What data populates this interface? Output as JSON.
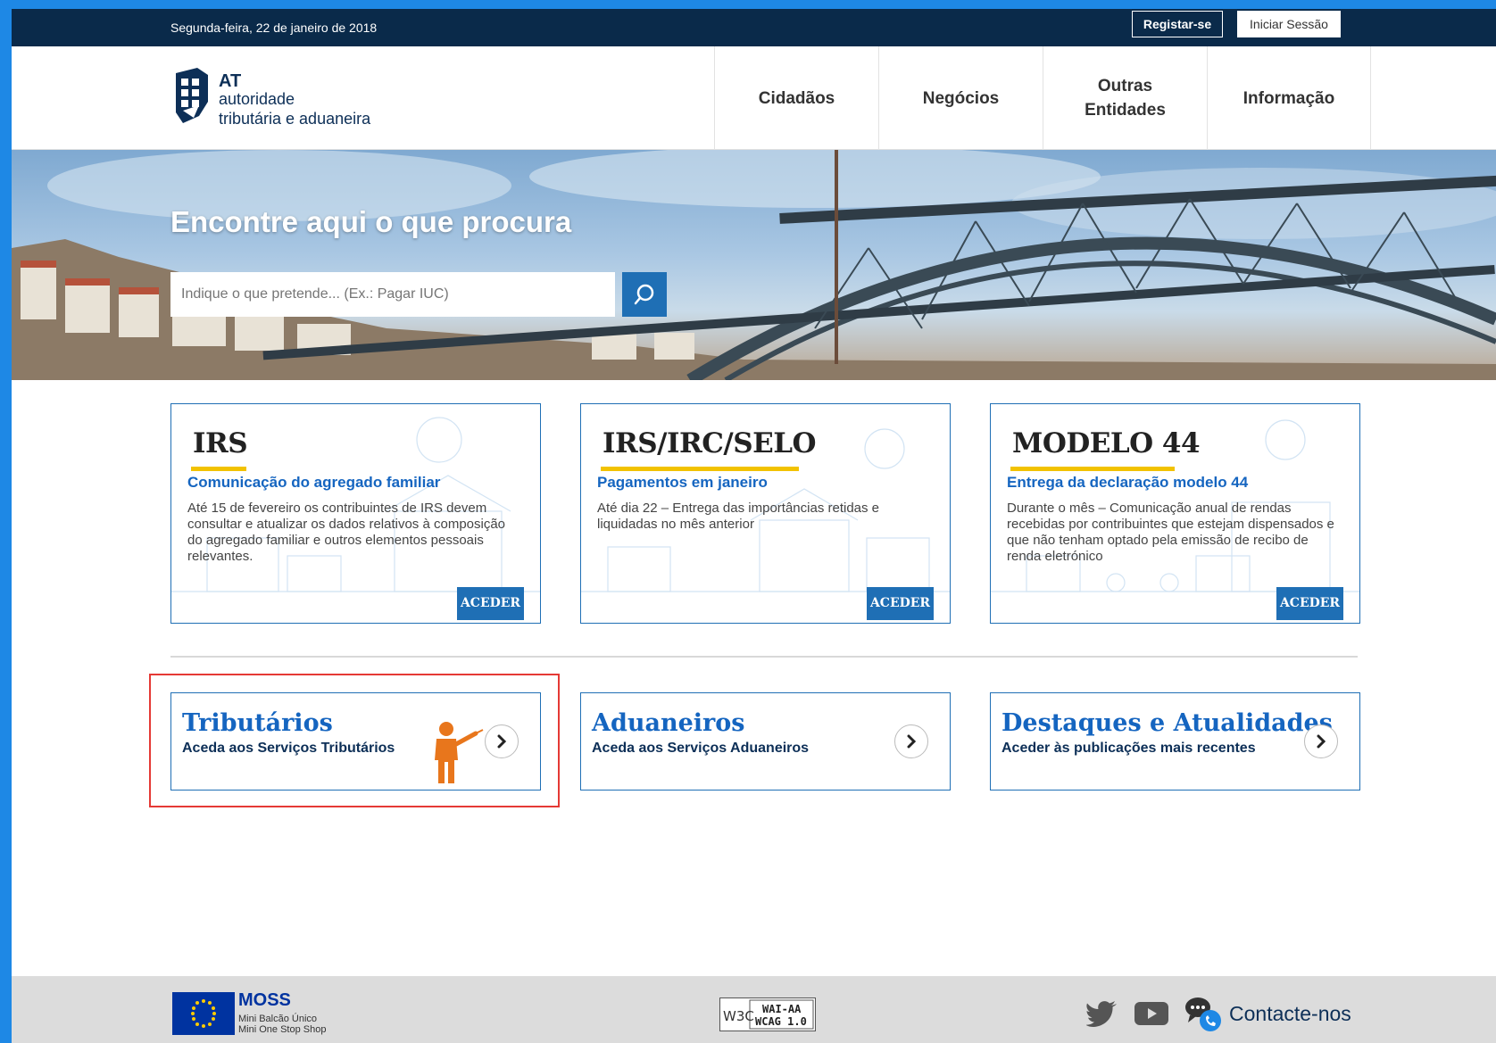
{
  "topbar": {
    "date": "Segunda-feira, 22 de janeiro de 2018",
    "register_label": "Registar-se",
    "login_label": "Iniciar Sessão"
  },
  "logo": {
    "abbr": "AT",
    "line1": "autoridade",
    "line2": "tributária e aduaneira"
  },
  "nav": {
    "items": [
      {
        "label": "Cidadãos"
      },
      {
        "label": "Negócios"
      },
      {
        "label": "Outras Entidades"
      },
      {
        "label": "Informação"
      }
    ]
  },
  "hero": {
    "title": "Encontre aqui o que procura",
    "search_placeholder": "Indique o que pretende... (Ex.: Pagar IUC)"
  },
  "cards": [
    {
      "title": "IRS",
      "subtitle": "Comunicação do agregado familiar",
      "description": "Até 15 de fevereiro os contribuintes de IRS devem consultar e atualizar os dados relativos à composição do agregado familiar e outros elementos pessoais relevantes.",
      "button": "ACEDER"
    },
    {
      "title": "IRS/IRC/SELO",
      "subtitle": "Pagamentos em janeiro",
      "description": "Até dia 22 – Entrega das importâncias retidas e liquidadas no mês anterior",
      "button": "ACEDER"
    },
    {
      "title": "MODELO 44",
      "subtitle": "Entrega da declaração modelo 44",
      "description": "Durante o mês – Comunicação anual de rendas recebidas por contribuintes que estejam dispensados e que não tenham optado pela emissão de recibo de renda eletrónico",
      "button": "ACEDER"
    }
  ],
  "services": [
    {
      "title": "Tributários",
      "subtitle": "Aceda aos Serviços Tributários"
    },
    {
      "title": "Aduaneiros",
      "subtitle": "Aceda aos Serviços Aduaneiros"
    },
    {
      "title": "Destaques e Atualidades",
      "subtitle": "Aceder às publicações mais recentes"
    }
  ],
  "footer": {
    "moss_title": "MOSS",
    "moss_line1": "Mini Balcão Único",
    "moss_line2": "Mini One Stop Shop",
    "wai_w3c": "W3C",
    "wai_line1": "WAI-AA",
    "wai_line2": "WCAG 1.0",
    "contact_label": "Contacte-nos"
  },
  "colors": {
    "background": "#1e88e5",
    "topbar": "#0a2a4a",
    "brand_blue": "#1f6fb5",
    "link_blue": "#1565c0",
    "accent_yellow": "#f2c200",
    "highlight_red": "#e53935",
    "pointer_orange": "#e8761c"
  }
}
